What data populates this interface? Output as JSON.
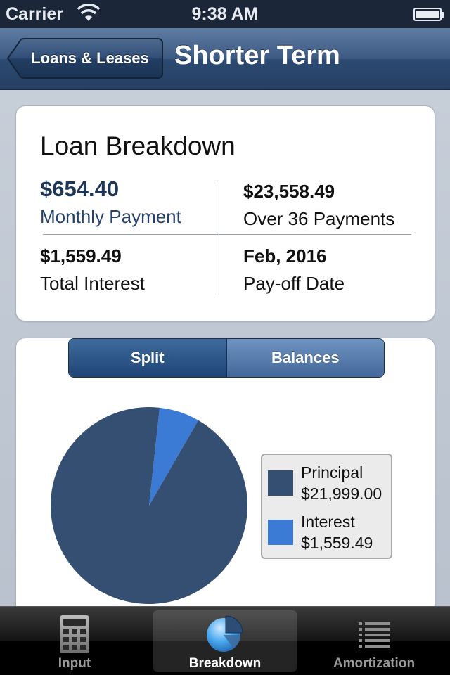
{
  "status_bar": {
    "carrier": "Carrier",
    "time": "9:38 AM"
  },
  "nav": {
    "back_label": "Loans & Leases",
    "title": "Shorter Term"
  },
  "breakdown": {
    "title": "Loan Breakdown",
    "monthly_payment": {
      "value": "$654.40",
      "label": "Monthly Payment"
    },
    "total_paid": {
      "value": "$23,558.49",
      "label": "Over 36 Payments"
    },
    "total_interest": {
      "value": "$1,559.49",
      "label": "Total Interest"
    },
    "payoff": {
      "value": "Feb, 2016",
      "label": "Pay-off Date"
    }
  },
  "segments": {
    "split": "Split",
    "balances": "Balances",
    "selected": "split"
  },
  "chart_data": {
    "type": "pie",
    "slices": [
      {
        "name": "Principal",
        "value": 21999.0,
        "display": "$21,999.00",
        "color": "#354f72"
      },
      {
        "name": "Interest",
        "value": 1559.49,
        "display": "$1,559.49",
        "color": "#3b7bd6"
      }
    ],
    "legend_position": "right"
  },
  "tabs": [
    {
      "label": "Input",
      "icon": "calculator-icon",
      "active": false
    },
    {
      "label": "Breakdown",
      "icon": "pie-chart-icon",
      "active": true
    },
    {
      "label": "Amortization",
      "icon": "list-icon",
      "active": false
    }
  ]
}
